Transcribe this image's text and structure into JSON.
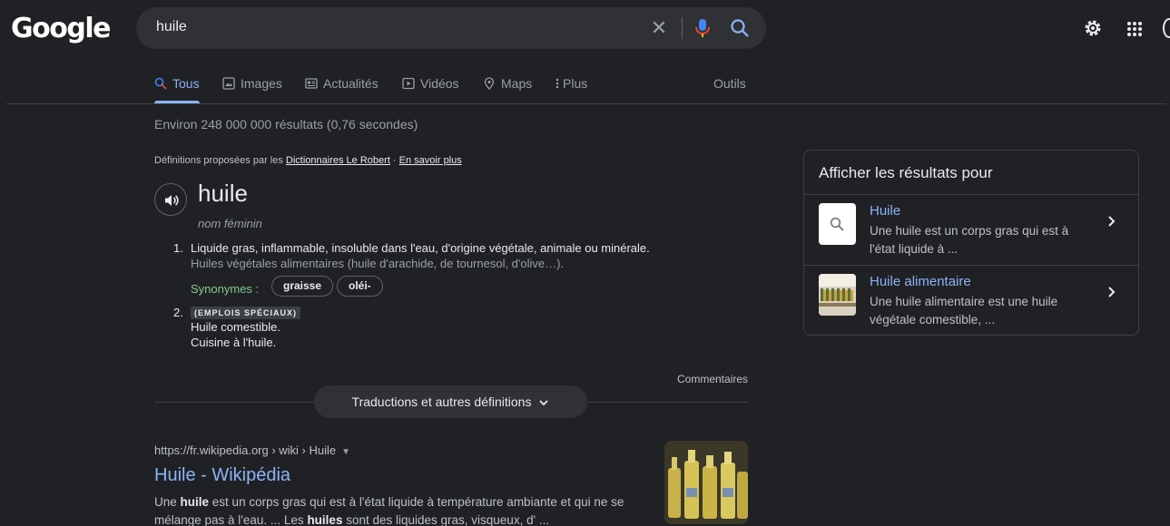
{
  "header": {
    "logo": "Google",
    "search_value": "huile"
  },
  "tabs": {
    "all": "Tous",
    "images": "Images",
    "news": "Actualités",
    "videos": "Vidéos",
    "maps": "Maps",
    "more": "Plus",
    "tools": "Outils"
  },
  "stats": "Environ 248 000 000 résultats (0,76 secondes)",
  "dictionary": {
    "source_prefix": "Définitions proposées par les",
    "source_link": "Dictionnaires Le Robert",
    "source_sep": " · ",
    "learn_more": "En savoir plus",
    "word": "huile",
    "pos": "nom féminin",
    "def1_num": "1.",
    "def1_text": "Liquide gras, inflammable, insoluble dans l'eau, d'origine végétale, animale ou minérale.",
    "def1_example": "Huiles végétales alimentaires (huile d'arachide, de tournesol, d'olive…).",
    "synonyms_label": "Synonymes :",
    "synonyms": [
      "graisse",
      "oléi-"
    ],
    "def2_num": "2.",
    "def2_tag": "(EMPLOIS SPÉCIAUX)",
    "def2_text": "Huile comestible.",
    "def2_example": "Cuisine à l'huile.",
    "feedback": "Commentaires",
    "translations_button": "Traductions et autres définitions"
  },
  "result": {
    "cite": "https://fr.wikipedia.org › wiki › Huile",
    "title": "Huile - Wikipédia",
    "snippet_1": "Une ",
    "snippet_b1": "huile",
    "snippet_2": " est un corps gras qui est à l'état liquide à température ambiante et qui ne se mélange pas à l'eau. ... Les ",
    "snippet_b2": "huiles",
    "snippet_3": " sont des liquides gras, visqueux, d' ..."
  },
  "panel": {
    "title": "Afficher les résultats pour",
    "items": [
      {
        "name": "Huile",
        "desc": "Une huile est un corps gras qui est à l'état liquide à ..."
      },
      {
        "name": "Huile alimentaire",
        "desc": "Une huile alimentaire est une huile végétale comestible, ..."
      }
    ]
  },
  "colors": {
    "background": "#202124",
    "link": "#8ab4f8",
    "synonym": "#81c995"
  }
}
